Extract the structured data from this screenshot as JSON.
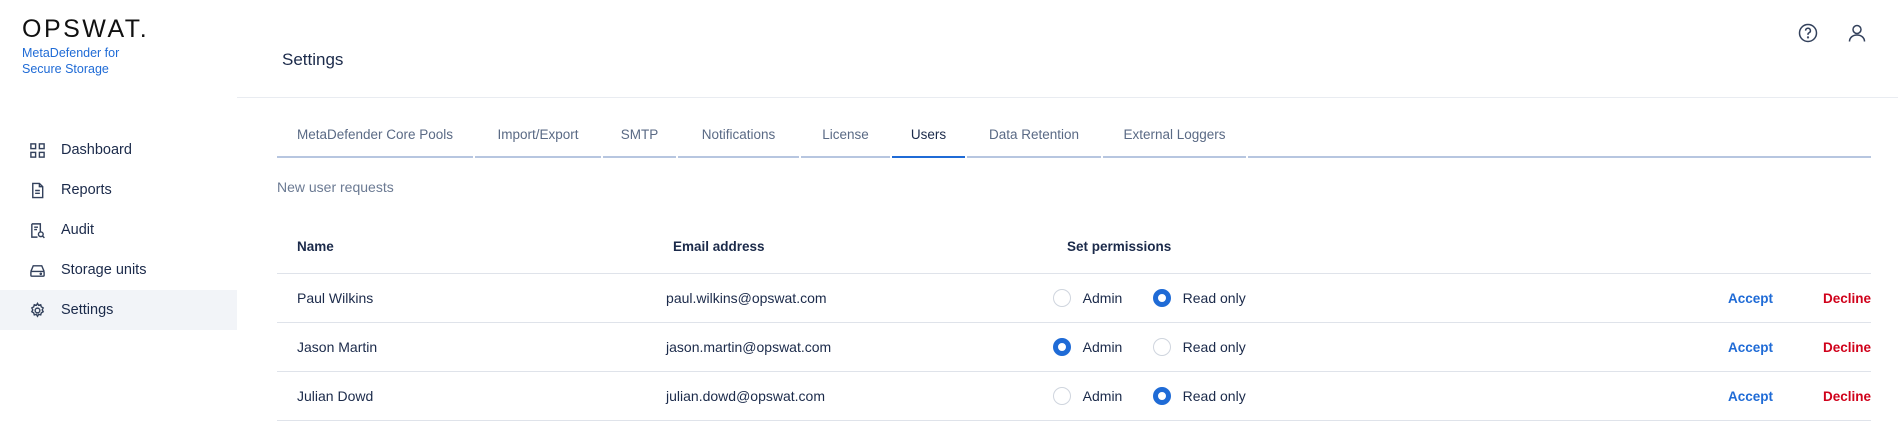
{
  "brand": {
    "logo": "OPSWAT.",
    "product": "MetaDefender for Secure Storage"
  },
  "sidebar": {
    "items": [
      {
        "label": "Dashboard",
        "icon": "grid-icon"
      },
      {
        "label": "Reports",
        "icon": "document-icon"
      },
      {
        "label": "Audit",
        "icon": "audit-icon"
      },
      {
        "label": "Storage units",
        "icon": "storage-icon"
      },
      {
        "label": "Settings",
        "icon": "gear-icon",
        "active": true
      }
    ]
  },
  "header": {
    "title": "Settings",
    "icons": [
      "help-icon",
      "user-icon"
    ]
  },
  "tabs": [
    {
      "label": "MetaDefender Core Pools"
    },
    {
      "label": "Import/Export"
    },
    {
      "label": "SMTP"
    },
    {
      "label": "Notifications"
    },
    {
      "label": "License"
    },
    {
      "label": "Users",
      "active": true
    },
    {
      "label": "Data Retention"
    },
    {
      "label": "External Loggers"
    }
  ],
  "section": {
    "title": "New user requests"
  },
  "table": {
    "columns": [
      "Name",
      "Email address",
      "Set permissions"
    ],
    "permission_options": [
      "Admin",
      "Read only"
    ],
    "actions": {
      "accept": "Accept",
      "decline": "Decline"
    },
    "rows": [
      {
        "name": "Paul Wilkins",
        "email": "paul.wilkins@opswat.com",
        "permission": "Read only"
      },
      {
        "name": "Jason Martin",
        "email": "jason.martin@opswat.com",
        "permission": "Admin"
      },
      {
        "name": "Julian Dowd",
        "email": "julian.dowd@opswat.com",
        "permission": "Read only"
      }
    ]
  },
  "colors": {
    "accent": "#1f6bd6",
    "decline": "#d0021b",
    "text": "#1b2a4a",
    "muted": "#6b7a93"
  }
}
